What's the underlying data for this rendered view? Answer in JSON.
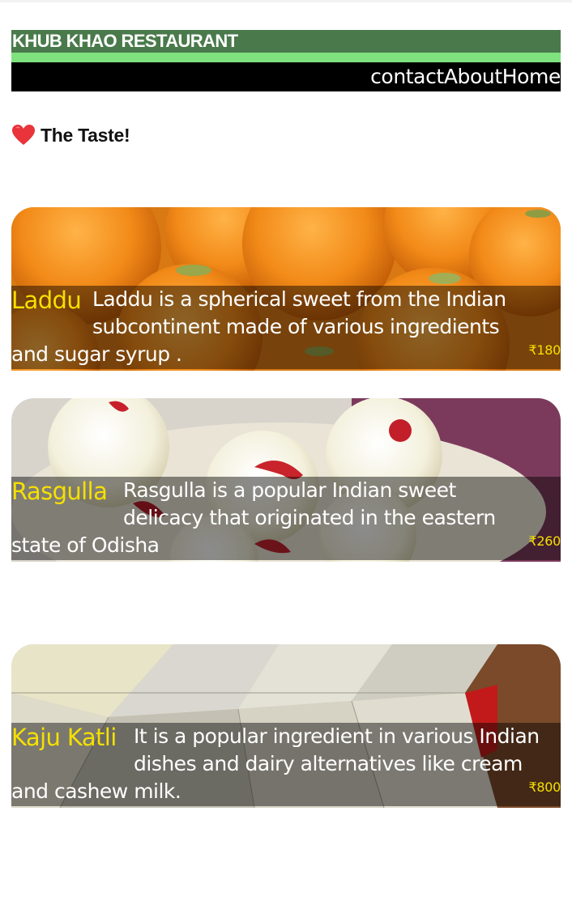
{
  "header": {
    "title": "KHUB KHAO RESTAURANT",
    "nav": [
      "contact",
      "About",
      "Home"
    ]
  },
  "tagline": {
    "icon": "heart-icon",
    "text": "The Taste!"
  },
  "menu": [
    {
      "name": "Laddu",
      "desc_line1": "Laddu is a spherical sweet from the Indian",
      "desc_line2": "subcontinent made of various ingredients",
      "desc_line3": "and sugar syrup .",
      "price": "₹180"
    },
    {
      "name": "Rasgulla",
      "desc_line1": "Rasgulla is a popular Indian sweet",
      "desc_line2": "delicacy that originated in the eastern",
      "desc_line3": "state of Odisha",
      "price": "₹260"
    },
    {
      "name": "Kaju Katli",
      "desc_line1": "It is a popular ingredient in various Indian",
      "desc_line2": "dishes and dairy alternatives like cream",
      "desc_line3": "and cashew milk.",
      "price": "₹800"
    }
  ],
  "colors": {
    "title_bar": "#4a7a4b",
    "accent_line": "#7fe27f",
    "nav_bar": "#000000",
    "item_name": "#f5e000",
    "price": "#f5e000"
  }
}
